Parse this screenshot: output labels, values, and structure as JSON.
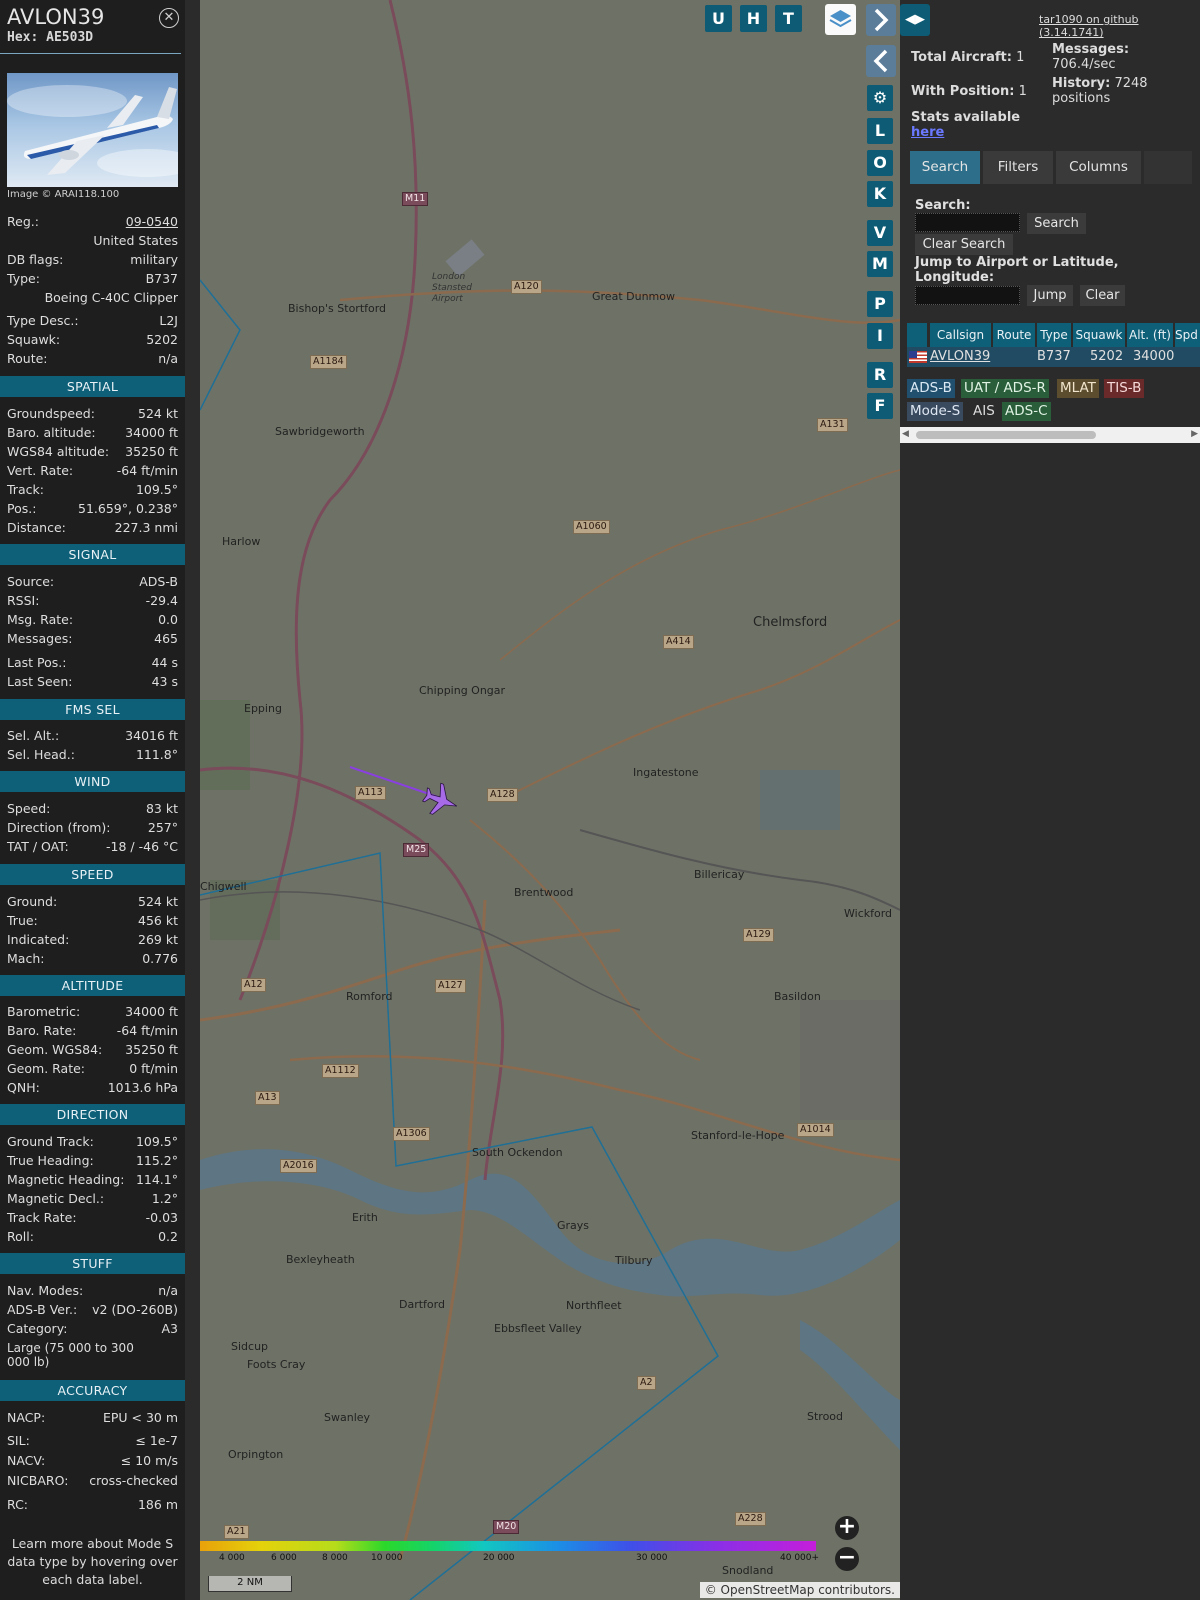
{
  "detail": {
    "callsign": "AVLON39",
    "hex": "Hex: AE503D",
    "photo_credit": "Image © ARAI118.100",
    "reg_label": "Reg.:",
    "reg": "09-0540",
    "country": "United States",
    "dbflags_label": "DB flags:",
    "dbflags": "military",
    "type_label": "Type:",
    "type": "B737",
    "type_full": "Boeing C-40C Clipper",
    "typedesc_label": "Type Desc.:",
    "typedesc": "L2J",
    "squawk_label": "Squawk:",
    "squawk": "5202",
    "route_label": "Route:",
    "route": "n/a"
  },
  "sections": [
    {
      "title": "SPATIAL",
      "rows": [
        {
          "k": "Groundspeed:",
          "v": "524 kt"
        },
        {
          "k": "Baro. altitude:",
          "v": "34000 ft"
        },
        {
          "k": "WGS84 altitude:",
          "v": "35250 ft"
        },
        {
          "k": "Vert. Rate:",
          "v": "-64 ft/min"
        },
        {
          "k": "Track:",
          "v": "109.5°"
        },
        {
          "k": "Pos.:",
          "v": "51.659°, 0.238°"
        },
        {
          "k": "Distance:",
          "v": "227.3 nmi"
        }
      ]
    },
    {
      "title": "SIGNAL",
      "rows": [
        {
          "k": "Source:",
          "v": "ADS-B"
        },
        {
          "k": "RSSI:",
          "v": "-29.4"
        },
        {
          "k": "Msg. Rate:",
          "v": "0.0"
        },
        {
          "k": "Messages:",
          "v": "465"
        },
        {
          "k": "Last Pos.:",
          "v": "44 s"
        },
        {
          "k": "Last Seen:",
          "v": "43 s"
        }
      ]
    },
    {
      "title": "FMS SEL",
      "rows": [
        {
          "k": "Sel. Alt.:",
          "v": "34016 ft"
        },
        {
          "k": "Sel. Head.:",
          "v": "111.8°"
        }
      ]
    },
    {
      "title": "WIND",
      "rows": [
        {
          "k": "Speed:",
          "v": "83 kt"
        },
        {
          "k": "Direction (from):",
          "v": "257°"
        },
        {
          "k": "TAT / OAT:",
          "v": "-18 / -46 °C"
        }
      ]
    },
    {
      "title": "SPEED",
      "rows": [
        {
          "k": "Ground:",
          "v": "524 kt"
        },
        {
          "k": "True:",
          "v": "456 kt"
        },
        {
          "k": "Indicated:",
          "v": "269 kt"
        },
        {
          "k": "Mach:",
          "v": "0.776"
        }
      ]
    },
    {
      "title": "ALTITUDE",
      "rows": [
        {
          "k": "Barometric:",
          "v": "34000 ft"
        },
        {
          "k": "Baro. Rate:",
          "v": "-64 ft/min"
        },
        {
          "k": "Geom. WGS84:",
          "v": "35250 ft"
        },
        {
          "k": "Geom. Rate:",
          "v": "0 ft/min"
        },
        {
          "k": "QNH:",
          "v": "1013.6 hPa"
        }
      ]
    },
    {
      "title": "DIRECTION",
      "rows": [
        {
          "k": "Ground Track:",
          "v": "109.5°"
        },
        {
          "k": "True Heading:",
          "v": "115.2°"
        },
        {
          "k": "Magnetic Heading:",
          "v": "114.1°"
        },
        {
          "k": "Magnetic Decl.:",
          "v": "1.2°"
        },
        {
          "k": "Track Rate:",
          "v": "-0.03"
        },
        {
          "k": "Roll:",
          "v": "0.2"
        }
      ]
    },
    {
      "title": "STUFF",
      "rows": [
        {
          "k": "Nav. Modes:",
          "v": "n/a"
        },
        {
          "k": "ADS-B Ver.:",
          "v": "v2 (DO-260B)"
        },
        {
          "k": "Category:",
          "v": "A3"
        },
        {
          "k": "Large (75 000 to 300 000 lb)",
          "v": ""
        }
      ]
    },
    {
      "title": "ACCURACY",
      "rows": [
        {
          "k": "NACP:",
          "v": "EPU < 30 m"
        },
        {
          "k": "SIL:",
          "v": "≤ 1e-7"
        },
        {
          "k": "NACV:",
          "v": "≤ 10 m/s"
        },
        {
          "k": "NICBARO:",
          "v": "cross-checked"
        },
        {
          "k": "RC:",
          "v": "186 m"
        }
      ]
    }
  ],
  "learn_more": "Learn more about Mode S data type by hovering over each data label.",
  "map": {
    "top_buttons": [
      "U",
      "H",
      "T"
    ],
    "side_buttons": [
      "L",
      "O",
      "K",
      "V",
      "M",
      "P",
      "I",
      "R",
      "F"
    ],
    "places": [
      "Bishop's Stortford",
      "Great Dunmow",
      "Sawbridgeworth",
      "Harlow",
      "Epping",
      "Chipping Ongar",
      "Chelmsford",
      "Ingatestone",
      "Chigwell",
      "Brentwood",
      "Billericay",
      "Wickford",
      "Romford",
      "Basildon",
      "Stanford-le-Hope",
      "South Ockendon",
      "Erith",
      "Grays",
      "Tilbury",
      "Bexleyheath",
      "Dartford",
      "Northfleet",
      "Ebbsfleet Valley",
      "Sidcup",
      "Foots Cray",
      "Swanley",
      "Strood",
      "Orpington",
      "Snodland",
      "London Stansted Airport"
    ],
    "roads": [
      "M11",
      "A120",
      "A1184",
      "A131",
      "A1060",
      "A414",
      "A113",
      "A128",
      "M25",
      "A129",
      "A12",
      "A127",
      "A1112",
      "A13",
      "A1306",
      "A2016",
      "A1014",
      "A2",
      "A228",
      "A21",
      "M20"
    ],
    "alt_legend": [
      "4 000",
      "6 000",
      "8 000",
      "10 000",
      "20 000",
      "30 000",
      "40 000+"
    ],
    "scale": "2 NM",
    "attribution": "© OpenStreetMap contributors."
  },
  "right": {
    "github": "tar1090 on github (3.14.1741)",
    "total_label": "Total Aircraft:",
    "total": "1",
    "withpos_label": "With Position:",
    "withpos": "1",
    "messages_label": "Messages:",
    "messages": "706.4/sec",
    "history_label": "History:",
    "history": "7248 positions",
    "stats_text": "Stats available",
    "stats_link": "here",
    "tabs": [
      "Search",
      "Filters",
      "Columns"
    ],
    "search_label": "Search:",
    "search_btn": "Search",
    "clear_search_btn": "Clear Search",
    "jump_label": "Jump to Airport or Latitude, Longitude:",
    "jump_btn": "Jump",
    "clear_btn": "Clear",
    "columns": [
      "Callsign",
      "Route",
      "Type",
      "Squawk",
      "Alt. (ft)",
      "Spd"
    ],
    "row": {
      "callsign": "AVLON39",
      "route": "",
      "type": "B737",
      "squawk": "5202",
      "alt": "34000"
    },
    "badges": [
      "ADS-B",
      "UAT / ADS-R",
      "MLAT",
      "TIS-B",
      "Mode-S",
      "AIS",
      "ADS-C"
    ]
  }
}
